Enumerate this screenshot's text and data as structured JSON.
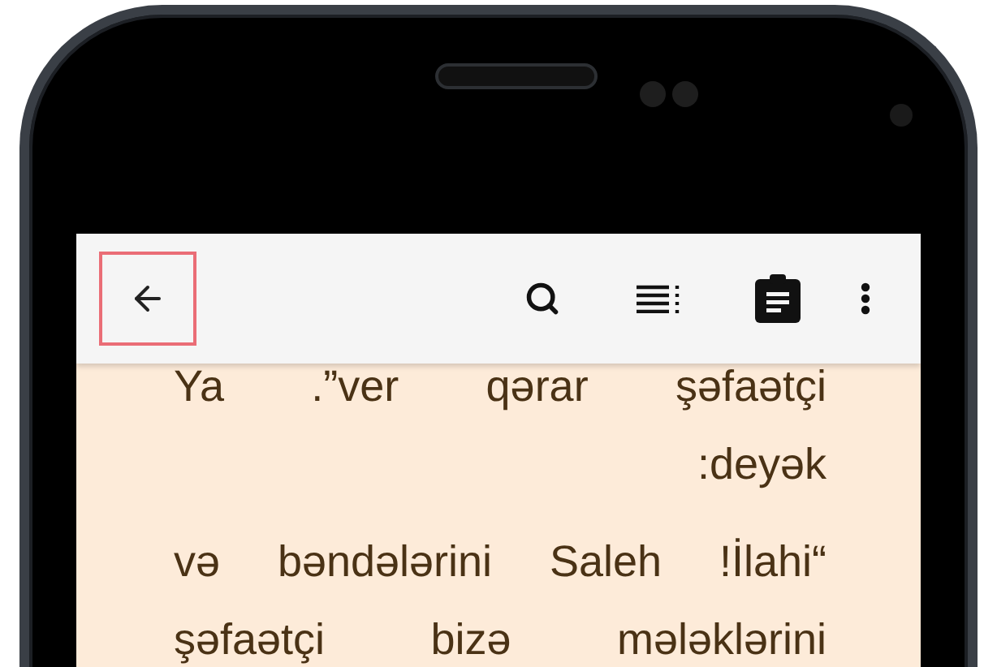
{
  "toolbar": {
    "back_button": {
      "highlighted": true
    }
  },
  "paragraphs": [
    {
      "lines": [
        "Ya .”ver qərar şəfaətçi",
        ":deyək"
      ]
    },
    {
      "lines": [
        "və bəndələrini Saleh !İlahi“",
        "şəfaətçi bizə mələklərini"
      ]
    }
  ]
}
